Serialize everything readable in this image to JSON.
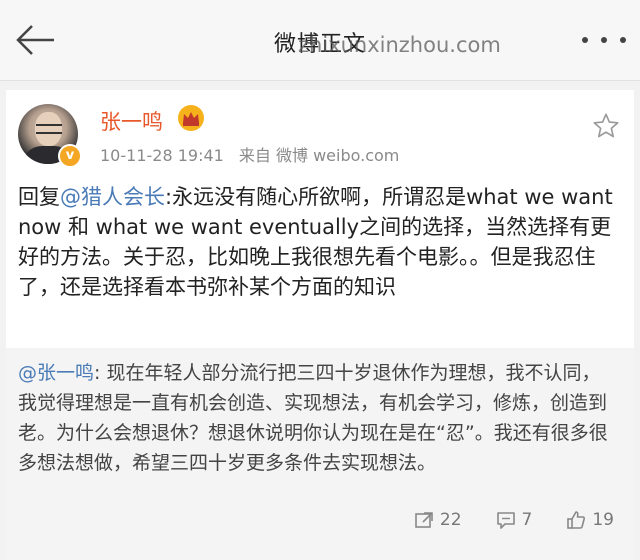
{
  "header": {
    "title": "微博正文",
    "watermark": "zhixunxinzhou.com",
    "back_icon": "arrow-left-icon",
    "more_icon": "more-dots-icon"
  },
  "post": {
    "username": "张一鸣",
    "badge_icon": "crown-badge-icon",
    "timestamp": "10-11-28 19:41",
    "source": "来自 微博 weibo.com",
    "star_icon": "star-icon",
    "reply_prefix": "回复",
    "reply_mention": "@猎人会长",
    "text": ":永远没有随心所欲啊，所谓忍是what we want now 和 what we want eventually之间的选择，当然选择有更好的方法。关于忍，比如晚上我很想先看个电影。。但是我忍住了，还是选择看本书弥补某个方面的知识"
  },
  "quoted": {
    "mention": "@张一鸣",
    "text": ": 现在年轻人部分流行把三四十岁退休作为理想，我不认同，我觉得理想是一直有机会创造、实现想法，有机会学习，修炼，创造到老。为什么会想退休？想退休说明你认为现在是在“忍”。我还有很多很多想法想做，希望三四十岁更多条件去实现想法。"
  },
  "actions": {
    "repost_count": "22",
    "comment_count": "7",
    "like_count": "19"
  },
  "colors": {
    "accent_orange": "#e8582b",
    "link_blue": "#4a7bb7",
    "badge_gold": "#f5a623"
  }
}
